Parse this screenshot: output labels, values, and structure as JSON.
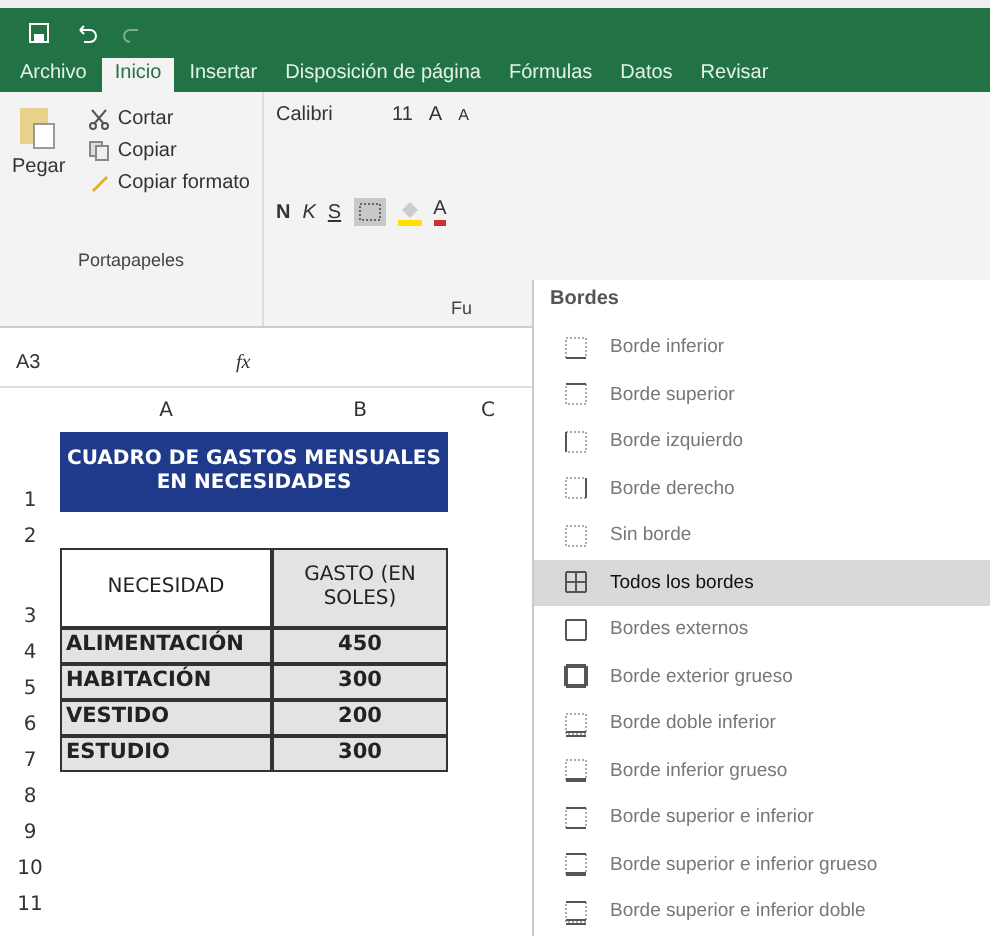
{
  "tabs": [
    {
      "label": "Archivo",
      "selected": false
    },
    {
      "label": "Inicio",
      "selected": true
    },
    {
      "label": "Insertar",
      "selected": false
    },
    {
      "label": "Disposición de página",
      "selected": false
    },
    {
      "label": "Fórmulas",
      "selected": false
    },
    {
      "label": "Datos",
      "selected": false
    },
    {
      "label": "Revisar",
      "selected": false
    }
  ],
  "clipboard": {
    "paste": "Pegar",
    "items": [
      {
        "kind": "cut",
        "label": "Cortar"
      },
      {
        "kind": "copy",
        "label": "Copiar"
      },
      {
        "kind": "format",
        "label": "Copiar formato"
      }
    ],
    "group_label": "Portapapeles"
  },
  "font": {
    "name": "Calibri",
    "size": "11",
    "grow": "A",
    "shrink": "A",
    "bold": "N",
    "italic": "K",
    "underline": "S",
    "color_letter": "A",
    "group_label": "Fu"
  },
  "formula_bar": {
    "cell": "A3",
    "fx": "fx"
  },
  "sheet": {
    "columns": [
      "A",
      "B",
      "C"
    ],
    "rows": [
      {
        "number": "1",
        "kind": "title",
        "cells": [
          "CUADRO DE GASTOS MENSUALES EN NECESIDADES"
        ]
      },
      {
        "number": "2",
        "kind": "empty",
        "cells": []
      },
      {
        "number": "3",
        "kind": "header",
        "cells": [
          "NECESIDAD",
          "GASTO (EN SOLES)"
        ]
      },
      {
        "number": "4",
        "kind": "data",
        "cells": [
          "ALIMENTACIÓN",
          "450"
        ]
      },
      {
        "number": "5",
        "kind": "data",
        "cells": [
          "HABITACIÓN",
          "300"
        ]
      },
      {
        "number": "6",
        "kind": "data",
        "cells": [
          "VESTIDO",
          "200"
        ]
      },
      {
        "number": "7",
        "kind": "data",
        "cells": [
          "ESTUDIO",
          "300"
        ]
      },
      {
        "number": "8",
        "kind": "empty",
        "cells": []
      },
      {
        "number": "9",
        "kind": "empty",
        "cells": []
      },
      {
        "number": "10",
        "kind": "empty",
        "cells": []
      },
      {
        "number": "11",
        "kind": "empty",
        "cells": []
      }
    ]
  },
  "borders_menu": {
    "title": "Bordes",
    "items": [
      {
        "label": "Borde inferior",
        "kind": "bottom",
        "selected": false
      },
      {
        "label": "Borde superior",
        "kind": "top",
        "selected": false
      },
      {
        "label": "Borde izquierdo",
        "kind": "left",
        "selected": false
      },
      {
        "label": "Borde derecho",
        "kind": "right",
        "selected": false
      },
      {
        "label": "Sin borde",
        "kind": "none",
        "selected": false
      },
      {
        "label": "Todos los bordes",
        "kind": "all",
        "selected": true
      },
      {
        "label": "Bordes externos",
        "kind": "outside",
        "selected": false
      },
      {
        "label": "Borde exterior grueso",
        "kind": "thick-outside",
        "selected": false
      },
      {
        "label": "Borde doble inferior",
        "kind": "double-bottom",
        "selected": false
      },
      {
        "label": "Borde inferior grueso",
        "kind": "thick-bottom",
        "selected": false
      },
      {
        "label": "Borde superior e inferior",
        "kind": "top-bottom",
        "selected": false
      },
      {
        "label": "Borde superior e inferior grueso",
        "kind": "top-thick-bottom",
        "selected": false
      },
      {
        "label": "Borde superior e inferior doble",
        "kind": "top-double-bottom",
        "selected": false
      }
    ]
  }
}
